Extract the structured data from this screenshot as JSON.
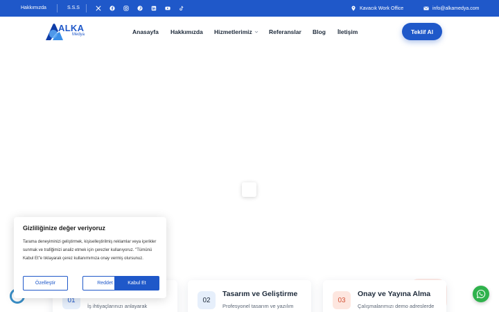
{
  "topbar": {
    "links": [
      "Hakkımızda",
      "S.S.S"
    ],
    "social_icons": [
      "x-icon",
      "facebook-icon",
      "instagram-icon",
      "pinterest-icon",
      "linkedin-icon",
      "youtube-icon",
      "tiktok-icon"
    ],
    "location": "Kavacık Work Office",
    "email": "info@alkamedya.com"
  },
  "header": {
    "logo_text": "ALKA",
    "logo_sub": "Medya",
    "nav": [
      "Anasayfa",
      "Hakkımızda",
      "Hizmetlerimiz",
      "Referanslar",
      "Blog",
      "İletişim"
    ],
    "cta": "Teklif Al"
  },
  "process_cards": [
    {
      "num": "01",
      "title": "",
      "desc": "İş ihtiyaçlarınızı anlayarak"
    },
    {
      "num": "02",
      "title": "Tasarım ve Geliştirme",
      "desc": "Profesyonel tasarım ve yazılım"
    },
    {
      "num": "03",
      "title": "Onay ve Yayına Alma",
      "desc": "Çalışmalarımızı demo adreslerde"
    }
  ],
  "cookie": {
    "title": "Gizliliğinize değer veriyoruz",
    "text": "Tarama deneyiminizi geliştirmek, kişiselleştirilmiş reklamlar veya içerikler sunmak ve trafiğimizi analiz etmek için çerezler kullanıyoruz. \"Tümünü Kabul Et\"e tıklayarak çerez kullanımımıza onay vermiş olursunuz.",
    "customize": "Özelleştir",
    "reject": "Reddet",
    "accept": "Kabul Et"
  },
  "colors": {
    "primary": "#1f58c9",
    "whatsapp": "#2fb24c"
  }
}
